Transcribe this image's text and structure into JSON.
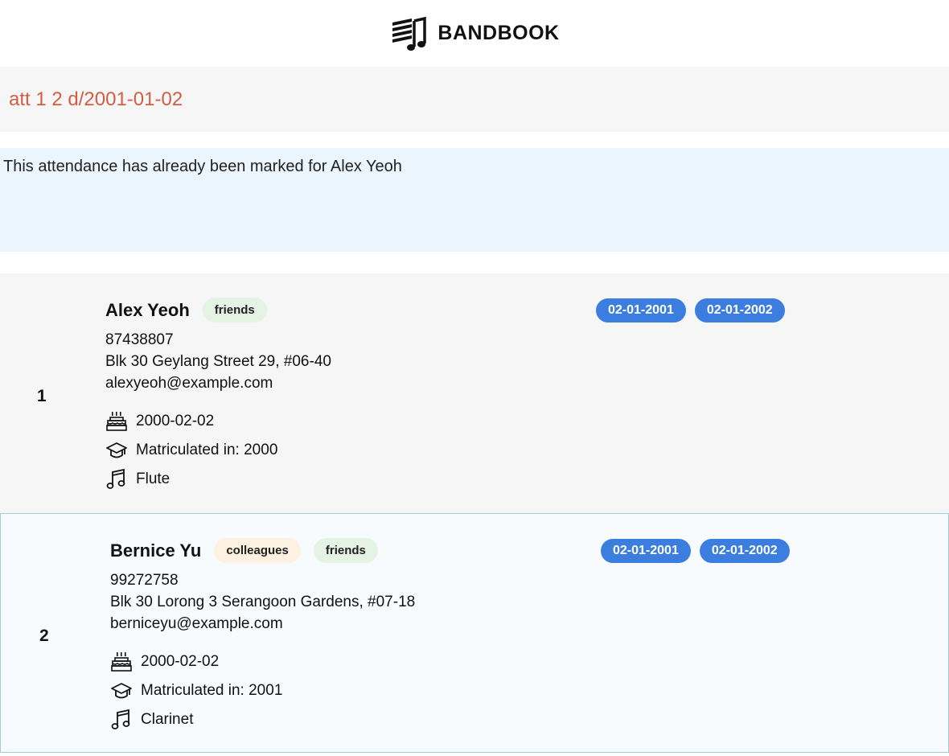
{
  "header": {
    "title": "BANDBOOK",
    "logo_icon": "band-sheet-music-logo-icon"
  },
  "command": {
    "value": "att 1 2 d/2001-01-02"
  },
  "result": {
    "message": "This attendance has already been marked for Alex Yeoh"
  },
  "persons": [
    {
      "index": "1",
      "name": "Alex Yeoh",
      "tags": [
        "friends"
      ],
      "phone": "87438807",
      "address": "Blk 30 Geylang Street 29, #06-40",
      "email": "alexyeoh@example.com",
      "birthday": "2000-02-02",
      "matriculation": "Matriculated in: 2000",
      "instrument": "Flute",
      "attendance": [
        "02-01-2001",
        "02-01-2002"
      ]
    },
    {
      "index": "2",
      "name": "Bernice Yu",
      "tags": [
        "colleagues",
        "friends"
      ],
      "phone": "99272758",
      "address": "Blk 30 Lorong 3 Serangoon Gardens, #07-18",
      "email": "berniceyu@example.com",
      "birthday": "2000-02-02",
      "matriculation": "Matriculated in: 2001",
      "instrument": "Clarinet",
      "attendance": [
        "02-01-2001",
        "02-01-2002"
      ]
    }
  ],
  "colors": {
    "command_text": "#d05e42",
    "result_bg": "#eaf5fe",
    "attendance_badge": "#3c7de0",
    "tag_friends": "#e5f3e4",
    "tag_colleagues": "#fdf1e1"
  }
}
